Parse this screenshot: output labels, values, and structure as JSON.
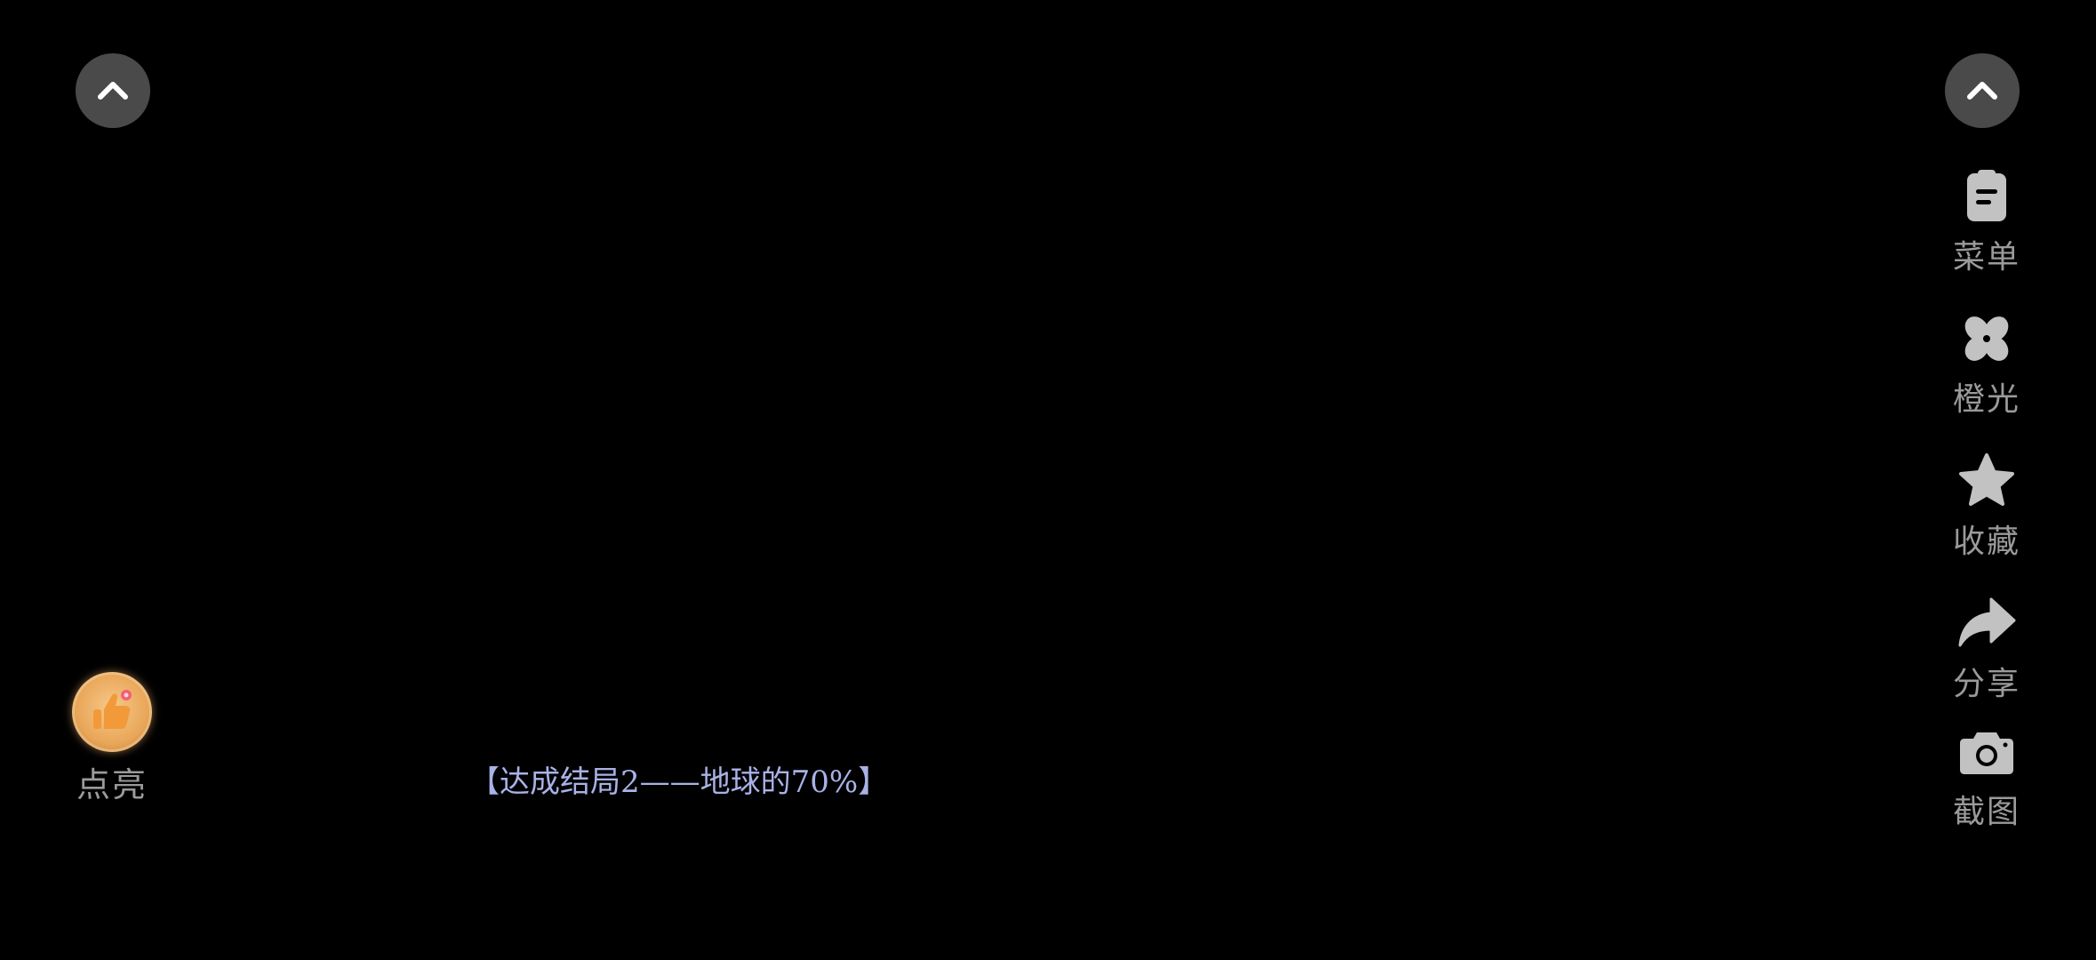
{
  "colors": {
    "background": "#000000",
    "button_bg": "#4a4a4a",
    "icon_gray": "#c2c2c2",
    "label_gray": "#9a9a9a",
    "dialog_text": "#a9b2e6",
    "like_orange": "#e9a659"
  },
  "left_panel": {
    "collapse_icon": "chevron-up-icon",
    "like": {
      "icon": "thumbs-up-icon",
      "label": "点亮"
    }
  },
  "right_panel": {
    "collapse_icon": "chevron-up-icon",
    "items": [
      {
        "icon": "menu-icon",
        "label": "菜单"
      },
      {
        "icon": "clover-icon",
        "label": "橙光"
      },
      {
        "icon": "star-icon",
        "label": "收藏"
      },
      {
        "icon": "share-icon",
        "label": "分享"
      },
      {
        "icon": "camera-icon",
        "label": "截图"
      }
    ]
  },
  "dialog": {
    "text": "【达成结局2——地球的70%】"
  }
}
